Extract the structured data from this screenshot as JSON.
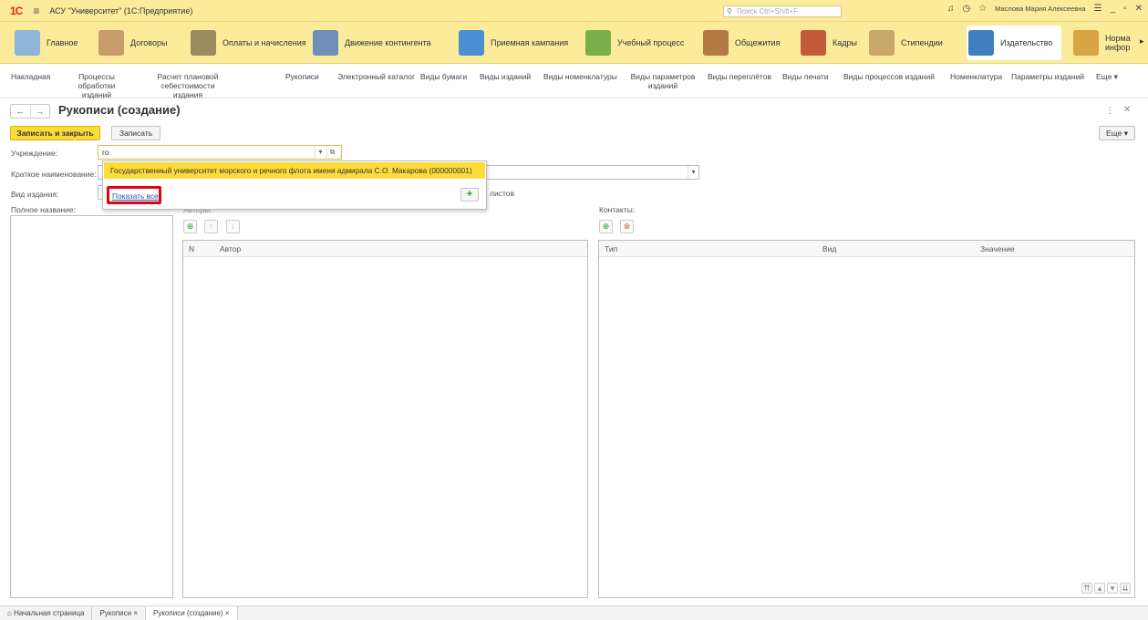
{
  "app": {
    "logo": "1С",
    "title": "АСУ \"Университет\" (1С:Предприятие)",
    "search_placeholder": "Поиск Ctrl+Shift+F",
    "user": "Маслова Мария Алексеевна"
  },
  "sections": [
    "Главное",
    "Договоры",
    "Оплаты и начисления",
    "Движение контингента",
    "Приемная кампания",
    "Учебный процесс",
    "Общежития",
    "Кадры",
    "Стипендии",
    "Издательство",
    "Норма инфор"
  ],
  "subnav": [
    "Накладная",
    "Процессы обработки изданий",
    "Расчет плановой себестоимости издания",
    "Рукописи",
    "Электронный каталог",
    "Виды бумаги",
    "Виды изданий",
    "Виды номенклатуры",
    "Виды параметров изданий",
    "Виды переплётов",
    "Виды печати",
    "Виды процессов изданий",
    "Номенклатура",
    "Параметры изданий",
    "Еще ▾"
  ],
  "form": {
    "title": "Рукописи (создание)",
    "save_close": "Записать и закрыть",
    "save": "Записать",
    "more": "Еще ▾",
    "institution_label": "Учреждение:",
    "institution_value": "го",
    "short_name_label": "Краткое наименование:",
    "pub_type_label": "Вид издания:",
    "sheets_suffix": "листов",
    "full_name_label": "Полное название:",
    "authors_label": "Авторы:",
    "authors_cols": [
      "N",
      "Автор"
    ],
    "contacts_label": "Контакты:",
    "contacts_cols": [
      "Тип",
      "Вид",
      "Значение"
    ]
  },
  "dropdown": {
    "item": "Государственный университет морского и речного флота имени адмирала С.О. Макарова (000000001)",
    "show_all": "Показать все",
    "add": "+"
  },
  "tabs": [
    "Начальная страница",
    "Рукописи ×",
    "Рукописи (создание) ×"
  ],
  "colors": {
    "accent": "#fbdc3b",
    "header": "#fbeb9b",
    "highlight": "#e3000f"
  }
}
